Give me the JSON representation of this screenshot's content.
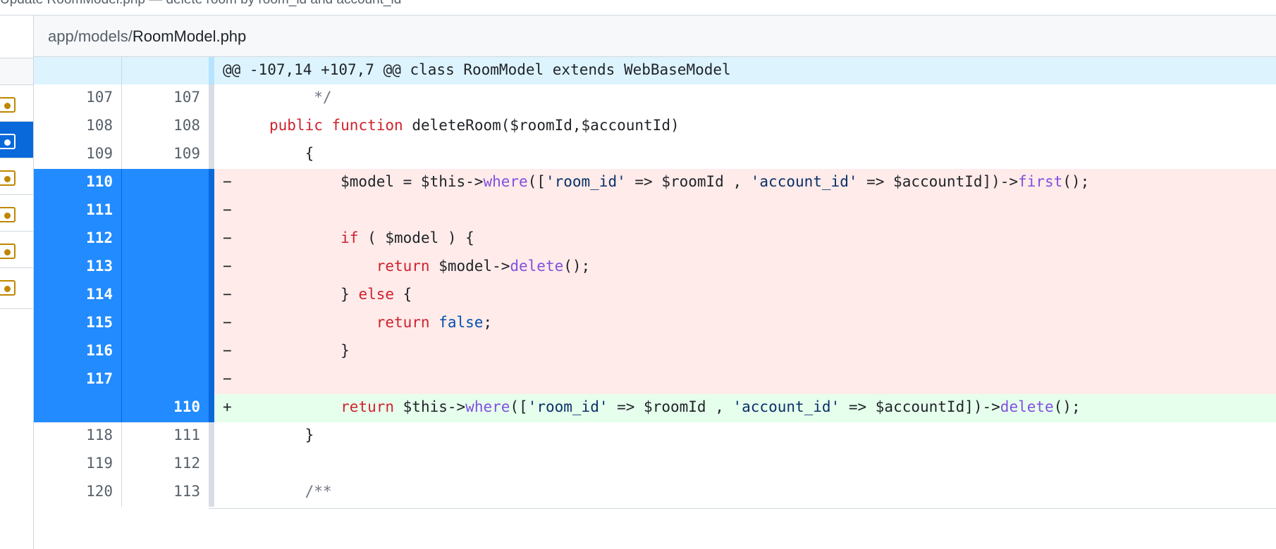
{
  "topbar": {
    "text": "Update RoomModel.php — delete room by room_id and account_id"
  },
  "sidebar": {
    "items": [
      {
        "state": "changed",
        "selected": false
      },
      {
        "state": "changed",
        "selected": true
      },
      {
        "state": "changed",
        "selected": false
      },
      {
        "state": "changed",
        "selected": false
      },
      {
        "state": "changed",
        "selected": false
      },
      {
        "state": "changed",
        "selected": false
      }
    ]
  },
  "file": {
    "dir": "app/models/",
    "name": "RoomModel.php"
  },
  "hunk_header": "@@ -107,14 +107,7 @@ class RoomModel extends WebBaseModel",
  "lines": [
    {
      "old": "107",
      "new": "107",
      "type": "ctx",
      "sign": ""
    },
    {
      "old": "108",
      "new": "108",
      "type": "ctx",
      "sign": ""
    },
    {
      "old": "109",
      "new": "109",
      "type": "ctx",
      "sign": ""
    },
    {
      "old": "110",
      "new": "",
      "type": "del",
      "sign": "−"
    },
    {
      "old": "111",
      "new": "",
      "type": "del",
      "sign": "−"
    },
    {
      "old": "112",
      "new": "",
      "type": "del",
      "sign": "−"
    },
    {
      "old": "113",
      "new": "",
      "type": "del",
      "sign": "−"
    },
    {
      "old": "114",
      "new": "",
      "type": "del",
      "sign": "−"
    },
    {
      "old": "115",
      "new": "",
      "type": "del",
      "sign": "−"
    },
    {
      "old": "116",
      "new": "",
      "type": "del",
      "sign": "−"
    },
    {
      "old": "117",
      "new": "",
      "type": "del",
      "sign": "−"
    },
    {
      "old": "",
      "new": "110",
      "type": "add",
      "sign": "+"
    },
    {
      "old": "118",
      "new": "111",
      "type": "ctx",
      "sign": ""
    },
    {
      "old": "119",
      "new": "112",
      "type": "ctx",
      "sign": ""
    },
    {
      "old": "120",
      "new": "113",
      "type": "ctx",
      "sign": ""
    }
  ],
  "code": {
    "l107": {
      "t1": "     */"
    },
    "l108": {
      "t1": "public",
      "t2": " ",
      "t3": "function",
      "t4": " deleteRoom($roomId,$accountId)"
    },
    "l109": {
      "t1": "    {"
    },
    "l110": {
      "t1": "        $model = $this->",
      "t2": "where",
      "t3": "([",
      "t4": "'room_id'",
      "t5": " => $roomId , ",
      "t6": "'account_id'",
      "t7": " => $accountId])->",
      "t8": "first",
      "t9": "();"
    },
    "l111": {
      "t1": ""
    },
    "l112": {
      "t1": "if",
      "t2": " ( $model ) {"
    },
    "l113": {
      "t1": "return",
      "t2": " $model->",
      "t3": "delete",
      "t4": "();"
    },
    "l114": {
      "t1": "} ",
      "t2": "else",
      "t3": " {"
    },
    "l115": {
      "t1": "return",
      "t2": " ",
      "t3": "false",
      "t4": ";"
    },
    "l116": {
      "t1": "}"
    },
    "l117": {
      "t1": ""
    },
    "n110": {
      "t1": "return",
      "t2": " $this->",
      "t3": "where",
      "t4": "([",
      "t5": "'room_id'",
      "t6": " => $roomId , ",
      "t7": "'account_id'",
      "t8": " => $accountId])->",
      "t9": "delete",
      "t10": "();"
    },
    "l118": {
      "t1": "}"
    },
    "l119": {
      "t1": ""
    },
    "l120": {
      "t1": "/**"
    }
  },
  "colors": {
    "keyword": "#cf222e",
    "function": "#8250df",
    "string": "#0a3069",
    "comment": "#6e7781",
    "constant": "#0550ae",
    "selection": "#218bff",
    "deleted_bg": "#ffebe9",
    "added_bg": "#e6ffec",
    "hunk_bg": "#ddf4ff"
  }
}
